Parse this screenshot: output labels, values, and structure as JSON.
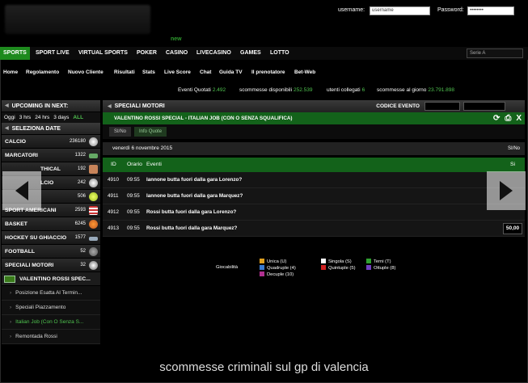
{
  "login": {
    "username_label": "username:",
    "username_value": "username",
    "password_label": "Password:",
    "password_value": "••••••••"
  },
  "logo_new": "new",
  "main_nav": [
    "SPORTS",
    "SPORT LIVE",
    "VIRTUAL SPORTS",
    "POKER",
    "CASINO",
    "LIVECASINO",
    "GAMES",
    "LOTTO"
  ],
  "serie_select": "Serie A",
  "sub_nav": [
    "Home",
    "Regolamento",
    "Nuovo Cliente",
    "Risultati",
    "Stats",
    "Live Score",
    "Chat",
    "Guida TV",
    "Il prenotatore",
    "Bet-Web"
  ],
  "stats": {
    "eventi_label": "Eventi Quotati",
    "eventi_value": "2.492",
    "scommesse_label": "scommesse disponibili",
    "scommesse_value": "252.539",
    "utenti_label": "utenti collegati",
    "utenti_value": "6",
    "giorno_label": "scommesse al giorno",
    "giorno_value": "23.791.898"
  },
  "sidebar": {
    "upcoming_title": "UPCOMING IN NEXT:",
    "time_filters": [
      "Oggi",
      "3 hrs",
      "24 hrs",
      "3 days",
      "ALL"
    ],
    "select_title": "SELEZIONA DATE",
    "sports": [
      {
        "name": "CALCIO",
        "count": "236180"
      },
      {
        "name": "MARCATORI",
        "count": "1322"
      },
      {
        "name": "THICAL",
        "count": "192"
      },
      {
        "name": "LCIO",
        "count": "242"
      },
      {
        "name": "",
        "count": "506"
      },
      {
        "name": "SPORT AMERICANI",
        "count": "2593"
      },
      {
        "name": "BASKET",
        "count": "6245"
      },
      {
        "name": "HOCKEY SU GHIACCIO",
        "count": "1577"
      },
      {
        "name": "FOOTBALL",
        "count": "52"
      },
      {
        "name": "SPECIALI MOTORI",
        "count": "32"
      }
    ],
    "selected_event": "VALENTINO ROSSI SPEC...",
    "sub_items": [
      "Posizione Esatta Al Termin...",
      "Speciali Piazzamento",
      "Italian Job (Con O Senza S...",
      "Remontada Rossi"
    ]
  },
  "content": {
    "title": "SPECIALI MOTORI",
    "codice_label": "CODICE EVENTO",
    "event_title": "VALENTINO ROSSI SPECIAL - ITALIAN JOB (CON O SENZA SQUALIFICA)",
    "tabs": [
      "SI/No",
      "Info Quote"
    ],
    "date": "venerdì 6 novembre 2015",
    "date_col": "SI/No",
    "columns": {
      "id": "ID",
      "orario": "Orario",
      "eventi": "Eventi",
      "si": "Si"
    },
    "rows": [
      {
        "id": "4910",
        "time": "09:55",
        "event": "lannone butta fuori dalla gara Lorenzo?",
        "odd": ""
      },
      {
        "id": "4911",
        "time": "09:55",
        "event": "lannone butta fuori dalla gara Marquez?",
        "odd": ""
      },
      {
        "id": "4912",
        "time": "09:55",
        "event": "Rossi butta fuori dalla gara Lorenzo?",
        "odd": ""
      },
      {
        "id": "4913",
        "time": "09:55",
        "event": "Rossi butta fuori dalla gara Marquez?",
        "odd": "50,00"
      }
    ],
    "legend_label": "Giocabilità",
    "legend": [
      {
        "text": "Unica (U)",
        "color": "#e0a020"
      },
      {
        "text": "Quadruple (4)",
        "color": "#3a7ad0"
      },
      {
        "text": "Decuple (10)",
        "color": "#b03090"
      },
      {
        "text": "Singola (S)",
        "color": "#ffffff"
      },
      {
        "text": "Quintuple (5)",
        "color": "#d02020"
      },
      {
        "text": "Terni (T)",
        "color": "#30a030"
      },
      {
        "text": "Ottuple (8)",
        "color": "#7040c0"
      }
    ]
  },
  "caption": "scommesse criminali sul gp di valencia"
}
